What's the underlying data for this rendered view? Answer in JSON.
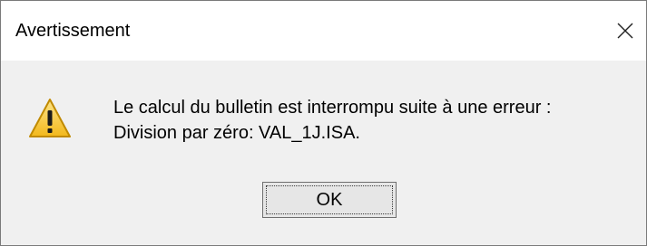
{
  "dialog": {
    "title": "Avertissement",
    "close_icon": "close-icon",
    "icon": "warning-icon",
    "message_lines": [
      "Le calcul du bulletin est interrompu suite à une erreur :",
      "Division par zéro: VAL_1J.ISA."
    ],
    "ok_label": "OK"
  },
  "colors": {
    "titlebar_bg": "#ffffff",
    "body_bg": "#f0f0f0",
    "warning_fill": "#f7c531",
    "warning_outline": "#c08a00"
  }
}
